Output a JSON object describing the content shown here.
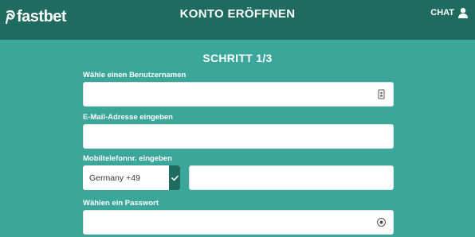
{
  "header": {
    "logo_text": "fastbet",
    "title": "KONTO ERÖFFNEN",
    "chat_label": "CHAT"
  },
  "form": {
    "step_title": "SCHRITT 1/3",
    "username": {
      "label": "Wähle einen Benutzernamen",
      "value": "",
      "placeholder": ""
    },
    "email": {
      "label": "E-Mail-Adresse eingeben",
      "value": "",
      "placeholder": ""
    },
    "mobile": {
      "label": "Mobiltelefonnr. eingeben",
      "country_selected": "Germany +49",
      "value": "",
      "placeholder": ""
    },
    "password": {
      "label": "Wählen ein Passwort",
      "value": "",
      "placeholder": ""
    }
  },
  "colors": {
    "background": "#3aa79a",
    "header": "#1f6b5f",
    "text_light": "#ffffff"
  },
  "icons": {
    "username_field": "contact-card-icon",
    "password_field": "eye-icon",
    "chat": "user-icon",
    "country_confirm": "check-icon"
  }
}
